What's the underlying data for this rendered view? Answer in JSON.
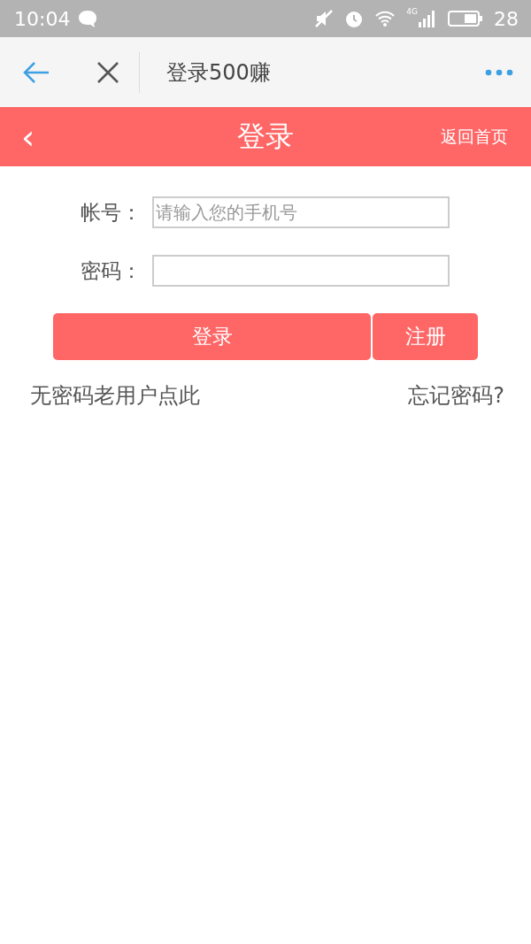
{
  "status_bar": {
    "time": "10:04",
    "network": "4G",
    "battery": "28"
  },
  "nav_bar": {
    "title": "登录500赚"
  },
  "header": {
    "back": "‹",
    "title": "登录",
    "home_link": "返回首页"
  },
  "form": {
    "fields": [
      {
        "label": "帐号：",
        "placeholder": "请输入您的手机号"
      },
      {
        "label": "密码："
      }
    ],
    "buttons": [
      "登录",
      "注册"
    ],
    "links": [
      "无密码老用户点此",
      "忘记密码?"
    ]
  }
}
